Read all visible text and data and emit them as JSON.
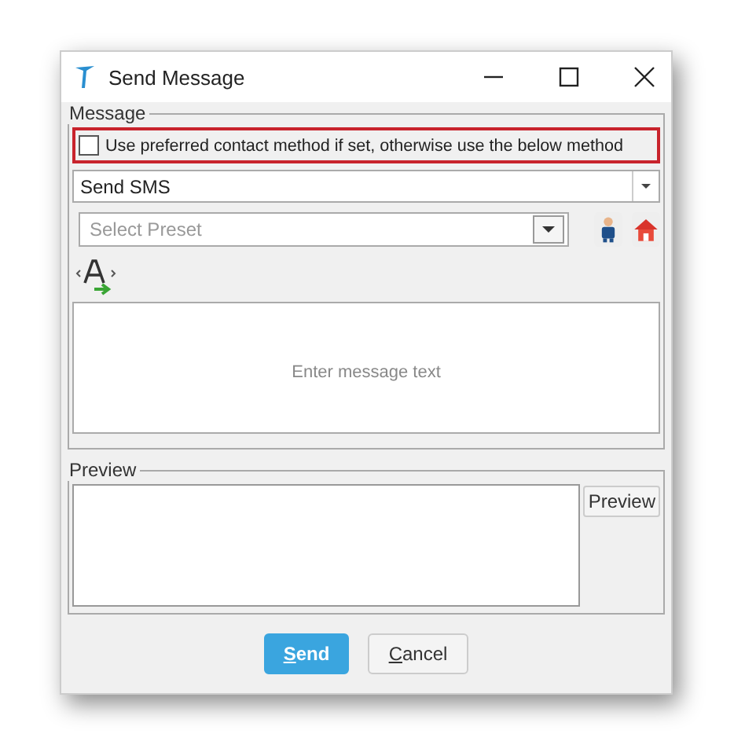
{
  "window": {
    "title": "Send Message"
  },
  "message_group": {
    "legend": "Message",
    "preference_checkbox": {
      "label": "Use preferred contact method if set, otherwise use the below method",
      "checked": false
    },
    "method_dropdown": {
      "value": "Send SMS"
    },
    "preset_dropdown": {
      "placeholder": "Select Preset"
    },
    "message_text": {
      "placeholder": "Enter message text"
    }
  },
  "preview_group": {
    "legend": "Preview",
    "preview_button": "Preview"
  },
  "buttons": [
    {
      "label": "Send",
      "kind": "primary"
    },
    {
      "label": "Cancel",
      "kind": "secondary"
    }
  ]
}
